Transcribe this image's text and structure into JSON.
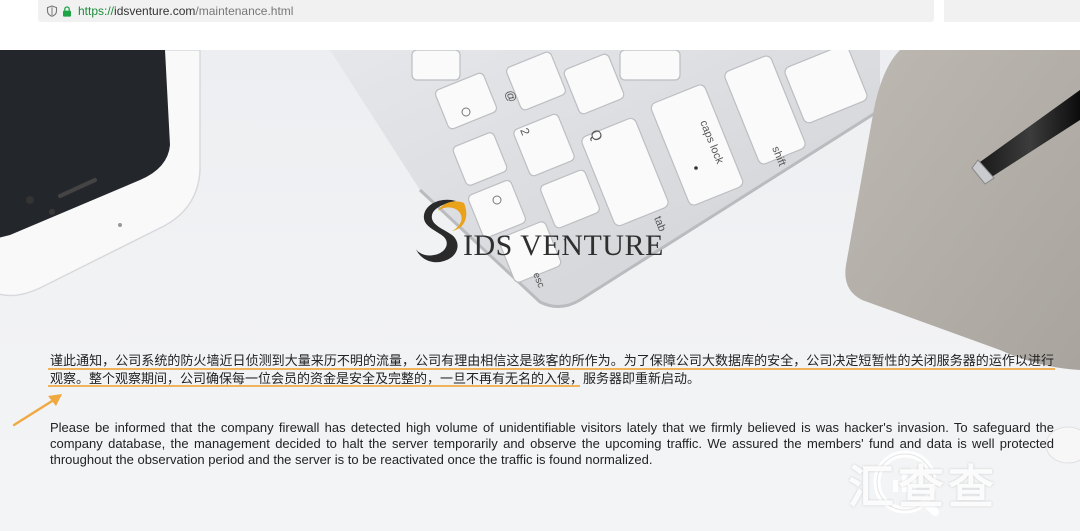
{
  "browser": {
    "url_scheme": "https://",
    "url_host": "idsventure.com",
    "url_path": "/maintenance.html"
  },
  "hero": {
    "keyboard_keys": [
      "@",
      "2",
      "Q",
      "caps lock",
      "tab",
      "shift",
      "~",
      "esc"
    ]
  },
  "logo": {
    "text": "IDS VENTURE"
  },
  "notice": {
    "chinese": "谨此通知，公司系统的防火墙近日侦测到大量来历不明的流量，公司有理由相信这是骇客的所作为。为了保障公司大数据库的安全，公司决定短暂性的关闭服务器的运作以进行观察。整个观察期间，公司确保每一位会员的资金是安全及完整的，一旦不再有无名的入侵，服务器即重新启动。",
    "english": "Please be informed that the company firewall has detected high volume of unidentifiable visitors lately that we firmly believed is was hacker's invasion. To safeguard the company database, the management decided to halt the server temporarily and observe the upcoming traffic. We assured the members' fund and data is well protected throughout the observation period and the server is to be reactivated once the traffic is found normalized."
  },
  "annotation": {
    "underline_color": "#f0b25a",
    "arrow_color": "#f0a840"
  },
  "watermark": {
    "text": "汇查查"
  }
}
